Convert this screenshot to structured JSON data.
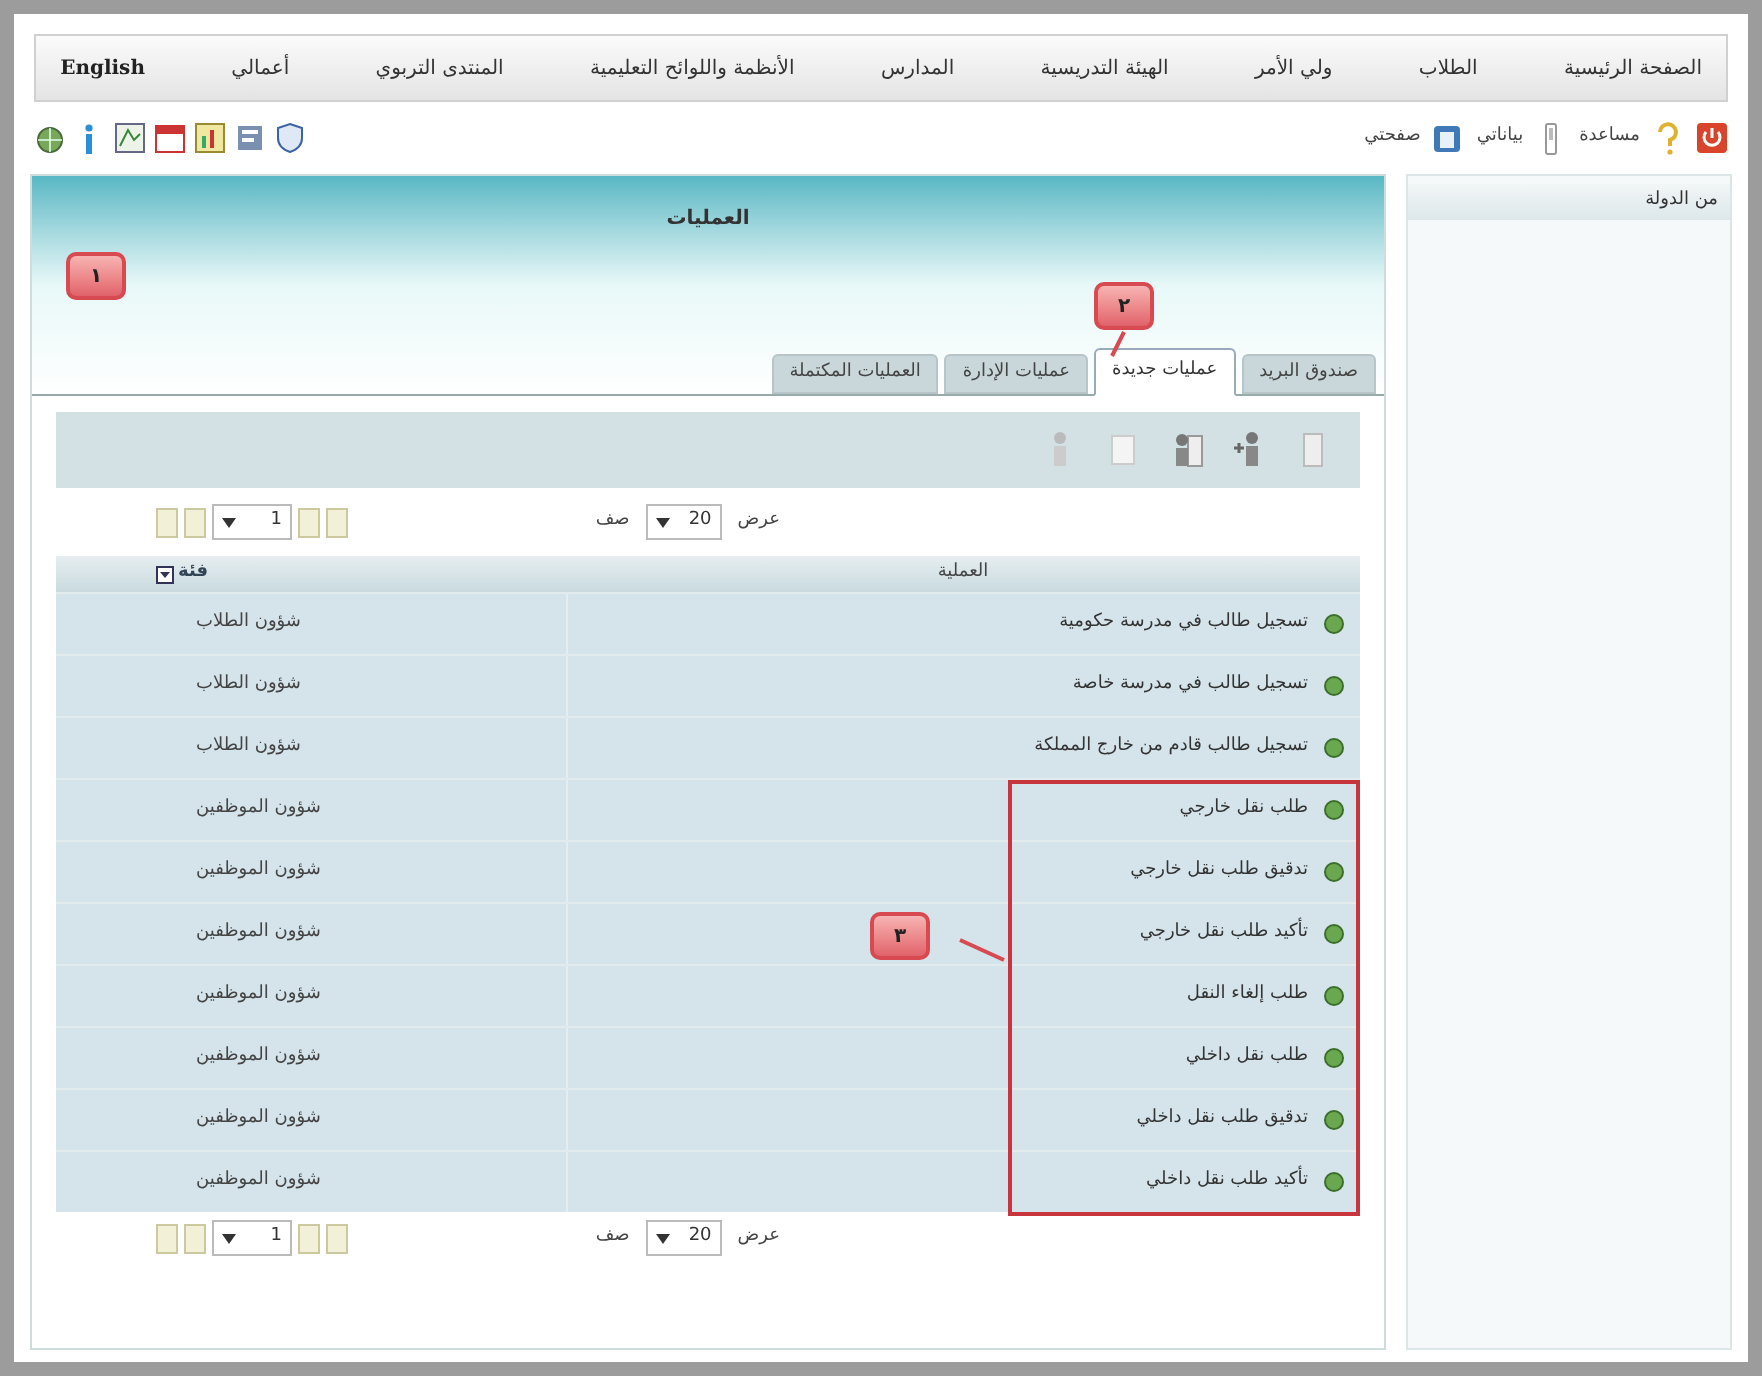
{
  "menu": [
    {
      "label": "الصفحة الرئيسية"
    },
    {
      "label": "الطلاب"
    },
    {
      "label": "ولي الأمر"
    },
    {
      "label": "الهيئة التدريسية"
    },
    {
      "label": "المدارس"
    },
    {
      "label": "الأنظمة واللوائح التعليمية"
    },
    {
      "label": "المنتدى التربوي"
    },
    {
      "label": "أعمالي"
    },
    {
      "label": "English",
      "kind": "language"
    }
  ],
  "user_links": [
    {
      "label": "مساعدة"
    },
    {
      "label": "بياناتي"
    },
    {
      "label": "صفحتي"
    }
  ],
  "sidebar": {
    "title": "من الدولة"
  },
  "panel": {
    "title": "العمليات",
    "tabs": [
      {
        "label": "صندوق البريد",
        "selected": false
      },
      {
        "label": "عمليات جديدة",
        "selected": true
      },
      {
        "label": "عمليات الإدارة",
        "selected": false
      },
      {
        "label": "العمليات المكتملة",
        "selected": false
      }
    ],
    "pager_top": {
      "show_label": "عرض",
      "page_size": "20",
      "rows_label": "صف",
      "page": "1"
    },
    "table": {
      "columns": [
        "العملية",
        "فئة"
      ],
      "rows": [
        {
          "operation": "تسجيل طالب في مدرسة حكومية",
          "category": "شؤون الطلاب"
        },
        {
          "operation": "تسجيل طالب في مدرسة خاصة",
          "category": "شؤون الطلاب"
        },
        {
          "operation": "تسجيل طالب قادم من خارج المملكة",
          "category": "شؤون الطلاب"
        },
        {
          "operation": "طلب نقل خارجي",
          "category": "شؤون الموظفين"
        },
        {
          "operation": "تدقيق طلب نقل خارجي",
          "category": "شؤون الموظفين"
        },
        {
          "operation": "تأكيد طلب نقل خارجي",
          "category": "شؤون الموظفين"
        },
        {
          "operation": "طلب إلغاء النقل",
          "category": "شؤون الموظفين"
        },
        {
          "operation": "طلب نقل داخلي",
          "category": "شؤون الموظفين"
        },
        {
          "operation": "تدقيق طلب نقل داخلي",
          "category": "شؤون الموظفين"
        },
        {
          "operation": "تأكيد طلب نقل داخلي",
          "category": "شؤون الموظفين"
        }
      ]
    },
    "pager_bottom": {
      "show_label": "عرض",
      "page_size": "20",
      "rows_label": "صف",
      "page": "1"
    }
  },
  "callouts": [
    {
      "label": "١"
    },
    {
      "label": "٢"
    },
    {
      "label": "٣"
    }
  ]
}
